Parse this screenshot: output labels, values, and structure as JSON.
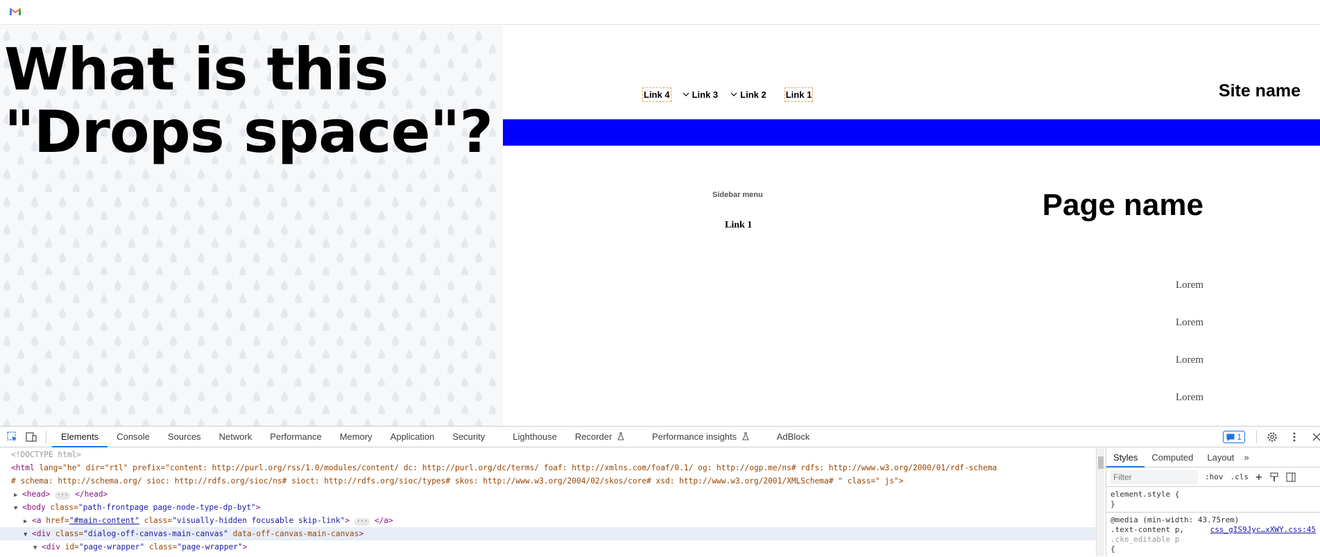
{
  "topbar": {
    "app_icon": "gmail-icon"
  },
  "article": {
    "headline_line1": "What is this",
    "headline_line2": "\"Drops space\"?"
  },
  "preview": {
    "site_name": "Site name",
    "nav": [
      {
        "label": "Link 4",
        "dropdown": false
      },
      {
        "label": "Link 3",
        "dropdown": true
      },
      {
        "label": "Link 2",
        "dropdown": true
      },
      {
        "label": "Link 1",
        "dropdown": false
      }
    ],
    "band_color": "#0000ff",
    "sidebar_title": "Sidebar menu",
    "sidebar_link": "Link 1",
    "page_name": "Page name",
    "lorem_items": [
      "Lorem",
      "Lorem",
      "Lorem",
      "Lorem"
    ]
  },
  "devtools": {
    "tabs": [
      "Elements",
      "Console",
      "Sources",
      "Network",
      "Performance",
      "Memory",
      "Application",
      "Security",
      "Lighthouse",
      "Recorder",
      "Performance insights",
      "AdBlock"
    ],
    "active_tab": "Elements",
    "issues_count": "1",
    "dom": {
      "doctype": "<!DOCTYPE html>",
      "html_open": "<html ",
      "html_attrs": "lang=\"he\" dir=\"rtl\" prefix=\"content: http://purl.org/rss/1.0/modules/content/  dc: http://purl.org/dc/terms/  foaf: http://xmlns.com/foaf/0.1/  og: http://ogp.me/ns#  rdfs: http://www.w3.org/2000/01/rdf-schema",
      "html_attrs2": "#  schema: http://schema.org/  sioc: http://rdfs.org/sioc/ns#  sioct: http://rdfs.org/sioc/types#  skos: http://www.w3.org/2004/02/skos/core#  xsd: http://www.w3.org/2001/XMLSchema# \" class=\" js\">",
      "head_open": "<head>",
      "head_close": "</head>",
      "body_tag": "<body ",
      "body_attr": "class=",
      "body_val": "\"path-frontpage page-node-type-dp-byt\"",
      "a_tag": "<a ",
      "a_href_attr": "href=",
      "a_href_val": "\"#main-content\"",
      "a_class_attr": " class=",
      "a_class_val": "\"visually-hidden focusable skip-link\"",
      "a_close": "</a>",
      "div1_tag": "<div ",
      "div1_attr": "class=",
      "div1_val": "\"dialog-off-canvas-main-canvas\"",
      "div1_attr2": " data-off-canvas-main-canvas",
      "div2_tag": "<div ",
      "div2_attr": "id=",
      "div2_val": "\"page-wrapper\"",
      "div2_attr2": " class=",
      "div2_val2": "\"page-wrapper\""
    },
    "styles": {
      "tabs": [
        "Styles",
        "Computed",
        "Layout"
      ],
      "active": "Styles",
      "filter_placeholder": "Filter",
      "hov": ":hov",
      "cls": ".cls",
      "element_style": "element.style {",
      "close_brace": "}",
      "media": "@media (min-width: 43.75rem)",
      "selector1": ".text-content p,",
      "selector2": ".cke_editable p",
      "source": "css_gIS9Jyc…xXWY.css:45",
      "open_brace": "{"
    }
  }
}
